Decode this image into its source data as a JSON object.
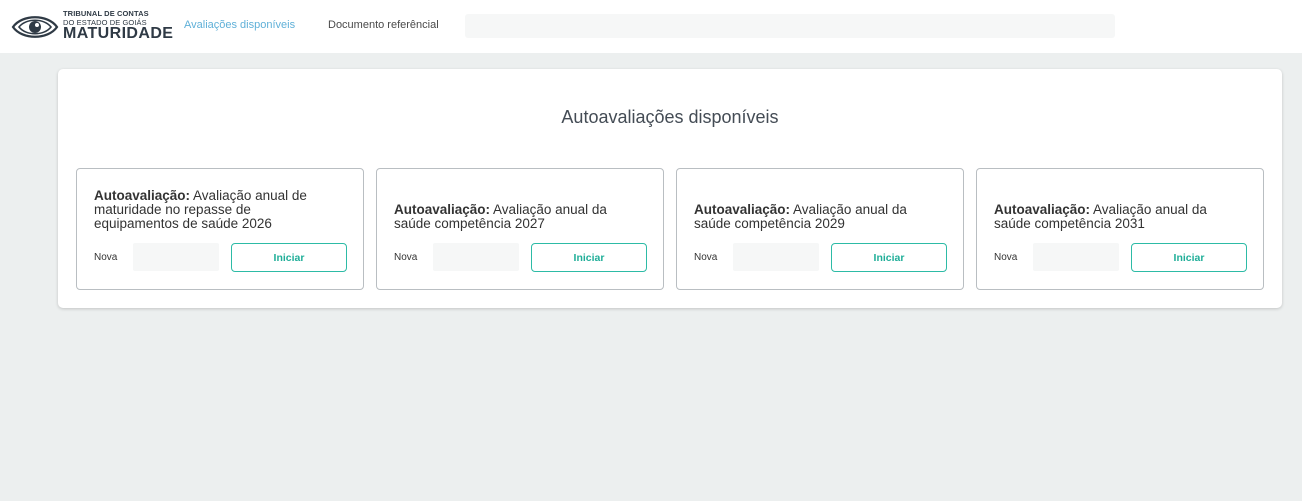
{
  "header": {
    "logo": {
      "line1": "TRIBUNAL DE CONTAS",
      "line2": "DO ESTADO DE GOIÁS",
      "line3": "MATURIDADE"
    },
    "nav": [
      {
        "label": "Avaliações disponíveis",
        "active": true
      },
      {
        "label": "Documento referêncial",
        "active": false
      }
    ]
  },
  "main": {
    "title": "Autoavaliações disponíveis",
    "cards": [
      {
        "prefix": "Autoavaliação:",
        "name": "Avaliação anual de maturidade no repasse de equipamentos de saúde 2026",
        "status": "Nova",
        "button": "Iniciar"
      },
      {
        "prefix": "Autoavaliação:",
        "name": "Avaliação anual da saúde competência 2027",
        "status": "Nova",
        "button": "Iniciar"
      },
      {
        "prefix": "Autoavaliação:",
        "name": "Avaliação anual da saúde competência 2029",
        "status": "Nova",
        "button": "Iniciar"
      },
      {
        "prefix": "Autoavaliação:",
        "name": "Avaliação anual da saúde competência 2031",
        "status": "Nova",
        "button": "Iniciar"
      }
    ]
  },
  "colors": {
    "accent": "#2dbba6",
    "nav_active": "#5fb0d8",
    "background": "#ecefef"
  }
}
